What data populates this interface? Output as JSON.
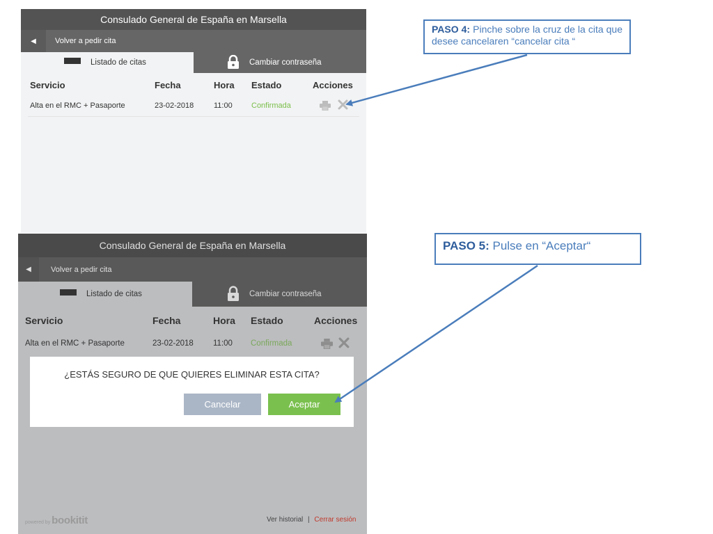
{
  "screen1": {
    "title": "Consulado General de España en Marsella",
    "back_label": "Volver a pedir cita",
    "tabs": [
      {
        "label": "Listado de citas"
      },
      {
        "label": "Cambiar contraseña"
      }
    ],
    "columns": [
      "Servicio",
      "Fecha",
      "Hora",
      "Estado",
      "Acciones"
    ],
    "row": {
      "service": "Alta en el RMC + Pasaporte",
      "date": "23-02-2018",
      "time": "11:00",
      "status": "Confirmada"
    }
  },
  "screen2": {
    "title": "Consulado General de España en Marsella",
    "back_label": "Volver a pedir cita",
    "tabs": [
      {
        "label": "Listado de citas"
      },
      {
        "label": "Cambiar contraseña"
      }
    ],
    "columns": [
      "Servicio",
      "Fecha",
      "Hora",
      "Estado",
      "Acciones"
    ],
    "row": {
      "service": "Alta en el RMC + Pasaporte",
      "date": "23-02-2018",
      "time": "11:00",
      "status": "Confirmada"
    },
    "dialog": {
      "question": "¿ESTÁS SEGURO DE QUE QUIERES ELIMINAR ESTA CITA?",
      "cancel_label": "Cancelar",
      "accept_label": "Aceptar"
    },
    "footer": {
      "powered_by": "powered by",
      "brand": "bookitit",
      "history_link": "Ver historial",
      "separator": "|",
      "logout_link": "Cerrar sesión"
    }
  },
  "callouts": {
    "step4_title": "PASO 4:",
    "step4_text": " Pinche sobre la cruz de la cita que desee cancelaren “cancelar cita “",
    "step5_title": "PASO 5:",
    "step5_text": " Pulse en “Aceptar“"
  },
  "colors": {
    "header": "#535353",
    "nav": "#666666",
    "status_green": "#7abf4a",
    "accept_green": "#7ac04e",
    "cancel_gray": "#aab6c6",
    "callout_blue": "#4a7dbb"
  },
  "icons": [
    "back-arrow-icon",
    "menu-icon",
    "lock-icon",
    "print-icon",
    "close-icon"
  ]
}
